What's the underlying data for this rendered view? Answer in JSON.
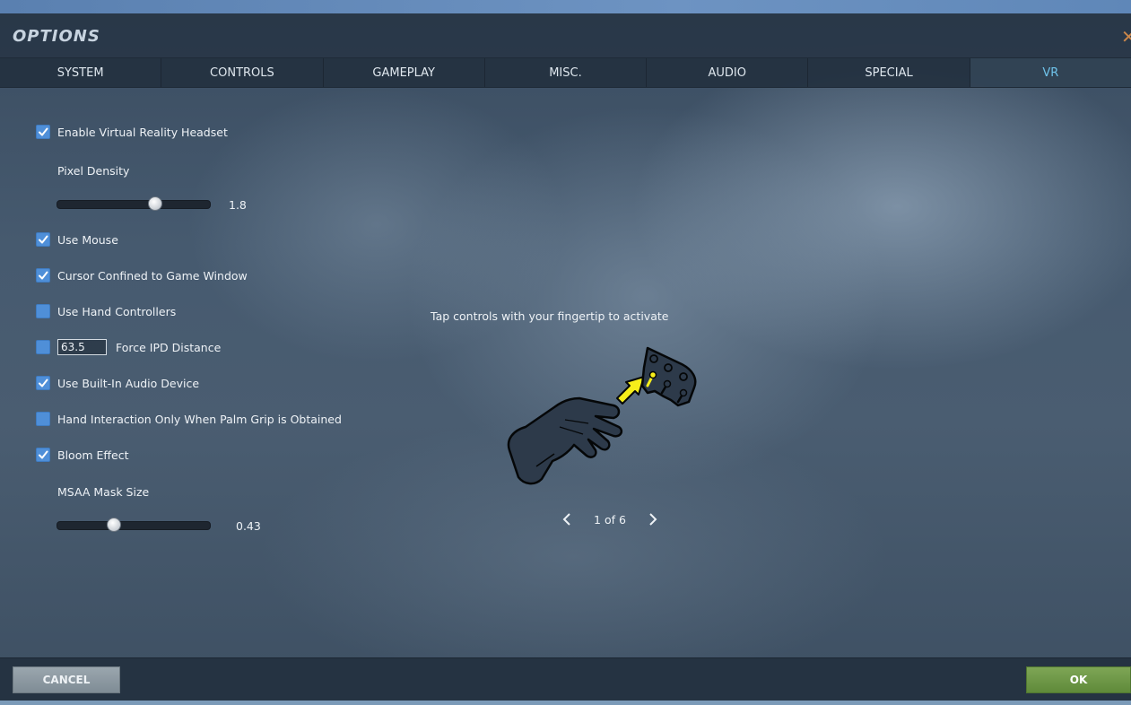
{
  "window": {
    "title": "OPTIONS",
    "close_icon": "close-icon"
  },
  "tabs": [
    {
      "label": "SYSTEM",
      "active": false
    },
    {
      "label": "CONTROLS",
      "active": false
    },
    {
      "label": "GAMEPLAY",
      "active": false
    },
    {
      "label": "MISC.",
      "active": false
    },
    {
      "label": "AUDIO",
      "active": false
    },
    {
      "label": "SPECIAL",
      "active": false
    },
    {
      "label": "VR",
      "active": true
    }
  ],
  "options": {
    "enable_vr": {
      "label": "Enable Virtual Reality Headset",
      "checked": true
    },
    "pixel_density": {
      "label": "Pixel Density",
      "value": "1.8",
      "fraction": 0.64
    },
    "use_mouse": {
      "label": "Use Mouse",
      "checked": true
    },
    "cursor_confined": {
      "label": "Cursor Confined to Game Window",
      "checked": true
    },
    "hand_controllers": {
      "label": "Use Hand Controllers",
      "checked": false
    },
    "force_ipd": {
      "label": "Force IPD Distance",
      "checked": false,
      "value": "63.5"
    },
    "builtin_audio": {
      "label": "Use Built-In Audio Device",
      "checked": true
    },
    "palm_grip": {
      "label": "Hand Interaction Only When Palm Grip is Obtained",
      "checked": false
    },
    "bloom": {
      "label": "Bloom Effect",
      "checked": true
    },
    "msaa_mask": {
      "label": "MSAA Mask Size",
      "value": "0.43",
      "fraction": 0.37
    }
  },
  "tutorial": {
    "hint": "Tap controls with your fingertip to activate",
    "page": "1 of 6"
  },
  "footer": {
    "cancel_label": "CANCEL",
    "ok_label": "OK"
  },
  "colors": {
    "accent_tab": "#6fc3ea",
    "checkbox": "#4f8fd8",
    "ok_button": "#6b9645",
    "cancel_button": "#8c98a0"
  }
}
